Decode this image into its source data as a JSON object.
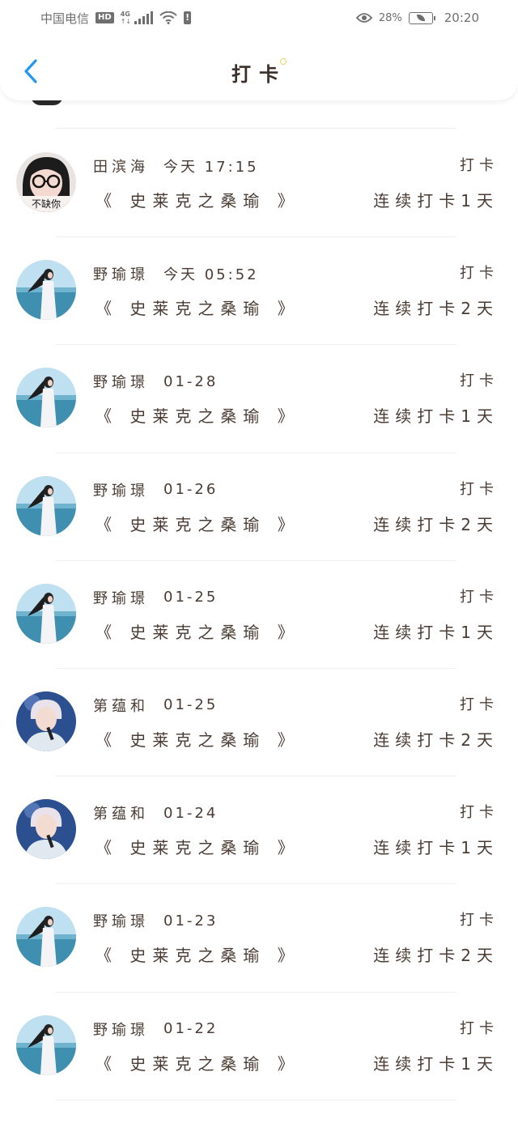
{
  "status_bar": {
    "carrier": "中国电信",
    "hd": "HD",
    "network": "4G",
    "battery_percent": "28%",
    "time": "20:20"
  },
  "header": {
    "title": "打卡"
  },
  "entries": [
    {
      "name": "田滨海",
      "time": "今天 17:15",
      "tag": "打卡",
      "book": "《 史莱克之桑瑜 》",
      "streak": "连续打卡1天",
      "avatar": "glasses-user"
    },
    {
      "name": "野瑜璟",
      "time": "今天 05:52",
      "tag": "打卡",
      "book": "《 史莱克之桑瑜 》",
      "streak": "连续打卡2天",
      "avatar": "sea-girl"
    },
    {
      "name": "野瑜璟",
      "time": "01-28",
      "tag": "打卡",
      "book": "《 史莱克之桑瑜 》",
      "streak": "连续打卡1天",
      "avatar": "sea-girl"
    },
    {
      "name": "野瑜璟",
      "time": "01-26",
      "tag": "打卡",
      "book": "《 史莱克之桑瑜 》",
      "streak": "连续打卡2天",
      "avatar": "sea-girl"
    },
    {
      "name": "野瑜璟",
      "time": "01-25",
      "tag": "打卡",
      "book": "《 史莱克之桑瑜 》",
      "streak": "连续打卡1天",
      "avatar": "sea-girl"
    },
    {
      "name": "第蕴和",
      "time": "01-25",
      "tag": "打卡",
      "book": "《 史莱克之桑瑜 》",
      "streak": "连续打卡2天",
      "avatar": "singer"
    },
    {
      "name": "第蕴和",
      "time": "01-24",
      "tag": "打卡",
      "book": "《 史莱克之桑瑜 》",
      "streak": "连续打卡1天",
      "avatar": "singer"
    },
    {
      "name": "野瑜璟",
      "time": "01-23",
      "tag": "打卡",
      "book": "《 史莱克之桑瑜 》",
      "streak": "连续打卡2天",
      "avatar": "sea-girl"
    },
    {
      "name": "野瑜璟",
      "time": "01-22",
      "tag": "打卡",
      "book": "《 史莱克之桑瑜 》",
      "streak": "连续打卡1天",
      "avatar": "sea-girl"
    }
  ],
  "glasses_avatar_caption": "不缺你",
  "colors": {
    "text": "#4a3c34",
    "back_arrow": "#2196f3",
    "heart": "#e86a87",
    "divider": "#efefef"
  }
}
